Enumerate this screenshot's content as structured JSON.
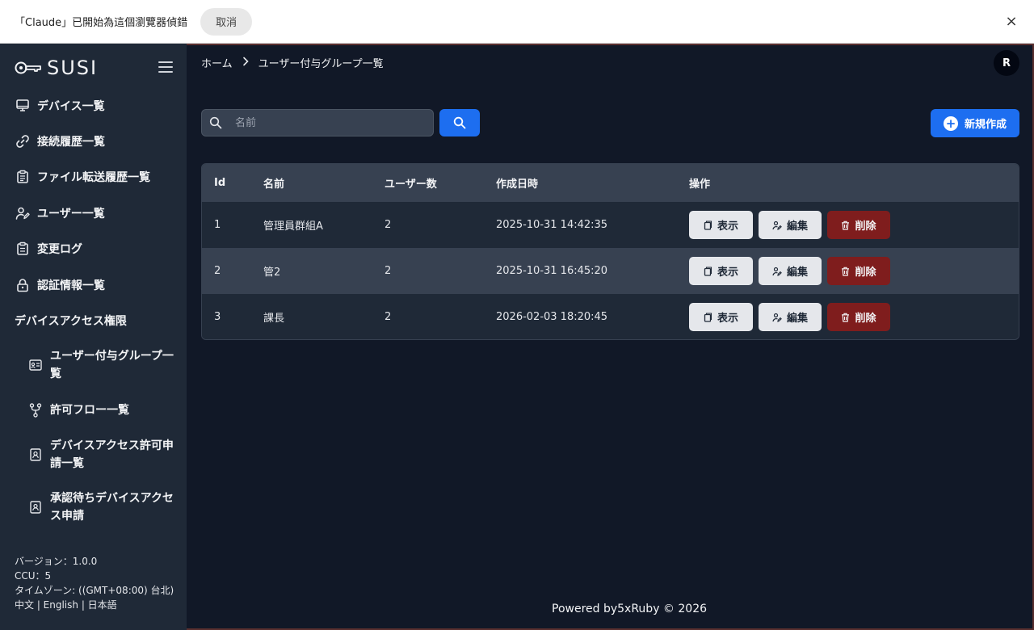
{
  "infobar": {
    "text": "「Claude」已開始為這個瀏覽器偵錯",
    "cancel_label": "取消",
    "close_icon": "×"
  },
  "sidebar": {
    "logo_text": "SUSI",
    "items": [
      {
        "label": "デバイス一覧",
        "icon": "monitor-icon"
      },
      {
        "label": "接続履歴一覧",
        "icon": "link-icon"
      },
      {
        "label": "ファイル転送履歴一覧",
        "icon": "clipboard-list-icon"
      },
      {
        "label": "ユーザー一覧",
        "icon": "user-edit-icon"
      },
      {
        "label": "変更ログ",
        "icon": "clipboard-icon"
      },
      {
        "label": "認証情報一覧",
        "icon": "lock-icon"
      }
    ],
    "section_title": "デバイスアクセス権限",
    "sub_items": [
      {
        "label": "ユーザー付与グループ一覧",
        "icon": "id-card-icon"
      },
      {
        "label": "許可フロー一覧",
        "icon": "git-fork-icon"
      },
      {
        "label": "デバイスアクセス許可申請一覧",
        "icon": "badge-icon"
      },
      {
        "label": "承認待ちデバイスアクセス申請",
        "icon": "badge-icon"
      }
    ],
    "footer": {
      "version": "バージョン：1.0.0",
      "ccu": "CCU：5",
      "timezone": "タイムゾーン: ((GMT+08:00) 台北)",
      "languages": "中文 | English | 日本語"
    }
  },
  "header": {
    "breadcrumb_home": "ホーム",
    "breadcrumb_current": "ユーザー付与グループ一覧",
    "avatar_initial": "R"
  },
  "toolbar": {
    "search_placeholder": "名前",
    "search_value": "",
    "new_label": "新規作成"
  },
  "table": {
    "columns": [
      "Id",
      "名前",
      "ユーザー数",
      "作成日時",
      "操作"
    ],
    "rows": [
      {
        "id": "1",
        "name": "管理員群組A",
        "users": "2",
        "created": "2025-10-31 14:42:35"
      },
      {
        "id": "2",
        "name": "管2",
        "users": "2",
        "created": "2025-10-31 16:45:20"
      },
      {
        "id": "3",
        "name": "課長",
        "users": "2",
        "created": "2026-02-03 18:20:45"
      }
    ],
    "actions": {
      "view": "表示",
      "edit": "編集",
      "delete": "削除"
    }
  },
  "footer": {
    "powered": "Powered by5xRuby © 2026"
  },
  "colors": {
    "primary": "#1d6ef0",
    "danger": "#7f1d1d",
    "sidebar_bg": "#1f2937",
    "main_bg": "#111827"
  }
}
